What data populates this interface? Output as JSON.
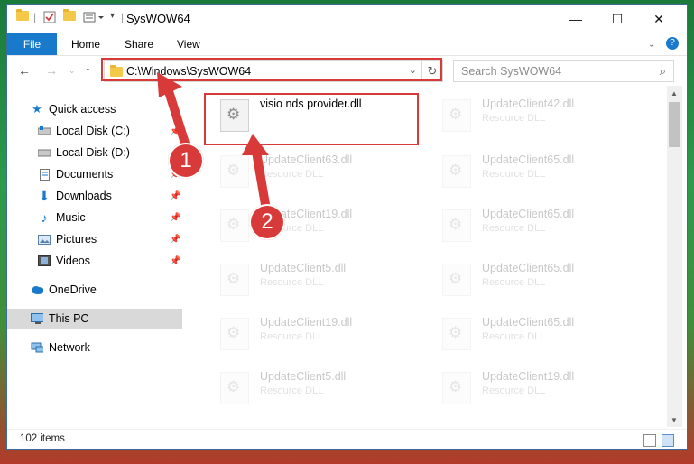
{
  "window": {
    "title": "SysWOW64"
  },
  "ribbon": {
    "tabs": [
      "File",
      "Home",
      "Share",
      "View"
    ],
    "help": "?"
  },
  "address": {
    "path": "C:\\Windows\\SysWOW64",
    "refresh": "↻"
  },
  "search": {
    "placeholder": "Search SysWOW64"
  },
  "nav": {
    "items": [
      {
        "label": "Quick access",
        "icon": "star-icon"
      },
      {
        "label": "Local Disk (C:)",
        "icon": "drive-icon"
      },
      {
        "label": "Local Disk (D:)",
        "icon": "drive-icon"
      },
      {
        "label": "Documents",
        "icon": "document-icon"
      },
      {
        "label": "Downloads",
        "icon": "download-icon"
      },
      {
        "label": "Music",
        "icon": "music-icon"
      },
      {
        "label": "Pictures",
        "icon": "pictures-icon"
      },
      {
        "label": "Videos",
        "icon": "videos-icon"
      },
      {
        "label": "OneDrive",
        "icon": "cloud-icon"
      },
      {
        "label": "This PC",
        "icon": "pc-icon"
      },
      {
        "label": "Network",
        "icon": "network-icon"
      }
    ]
  },
  "files": [
    {
      "name": "visio nds provider.dll",
      "type": ""
    },
    {
      "name": "UpdateClient42.dll",
      "type": "Resource DLL"
    },
    {
      "name": "UpdateClient63.dll",
      "type": "Resource DLL"
    },
    {
      "name": "UpdateClient65.dll",
      "type": "Resource DLL"
    },
    {
      "name": "UpdateClient19.dll",
      "type": "Resource DLL"
    },
    {
      "name": "UpdateClient65.dll",
      "type": "Resource DLL"
    },
    {
      "name": "UpdateClient5.dll",
      "type": "Resource DLL"
    },
    {
      "name": "UpdateClient65.dll",
      "type": "Resource DLL"
    },
    {
      "name": "UpdateClient19.dll",
      "type": "Resource DLL"
    },
    {
      "name": "UpdateClient65.dll",
      "type": "Resource DLL"
    },
    {
      "name": "UpdateClient5.dll",
      "type": "Resource DLL"
    },
    {
      "name": "UpdateClient19.dll",
      "type": "Resource DLL"
    }
  ],
  "status": {
    "count": "102 items"
  },
  "annotations": {
    "step1": "1",
    "step2": "2"
  },
  "colors": {
    "accent": "#1979ca",
    "annotation": "#d83a3a"
  }
}
